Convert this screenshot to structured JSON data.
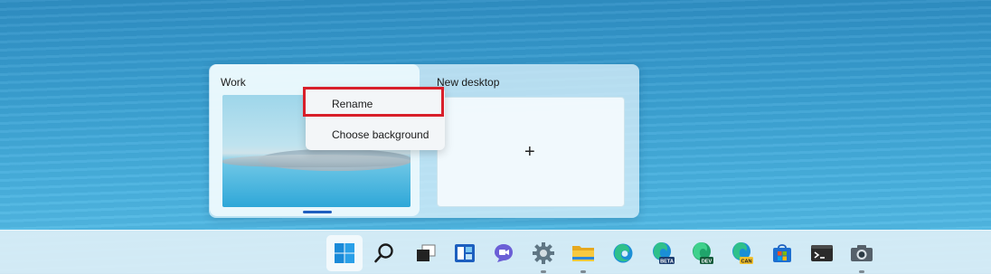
{
  "task_view": {
    "desktops": [
      {
        "label": "Work",
        "active": true
      },
      {
        "label": "New desktop",
        "add_symbol": "+"
      }
    ]
  },
  "context_menu": {
    "items": [
      {
        "label": "Rename",
        "highlighted": true
      },
      {
        "label": "Choose background"
      }
    ]
  },
  "taskbar": {
    "items": [
      {
        "name": "start-icon"
      },
      {
        "name": "search-icon"
      },
      {
        "name": "task-view-icon"
      },
      {
        "name": "widgets-icon"
      },
      {
        "name": "teams-chat-icon"
      },
      {
        "name": "settings-icon",
        "running": true
      },
      {
        "name": "file-explorer-icon",
        "running": true
      },
      {
        "name": "edge-icon"
      },
      {
        "name": "edge-beta-icon",
        "badge": "BETA"
      },
      {
        "name": "edge-dev-icon",
        "badge": "DEV"
      },
      {
        "name": "edge-canary-icon",
        "badge": "CAN"
      },
      {
        "name": "microsoft-store-icon"
      },
      {
        "name": "terminal-icon"
      },
      {
        "name": "camera-icon",
        "running": true
      }
    ]
  },
  "colors": {
    "highlight_box": "#d81f2a",
    "accent": "#1f5fbf"
  }
}
